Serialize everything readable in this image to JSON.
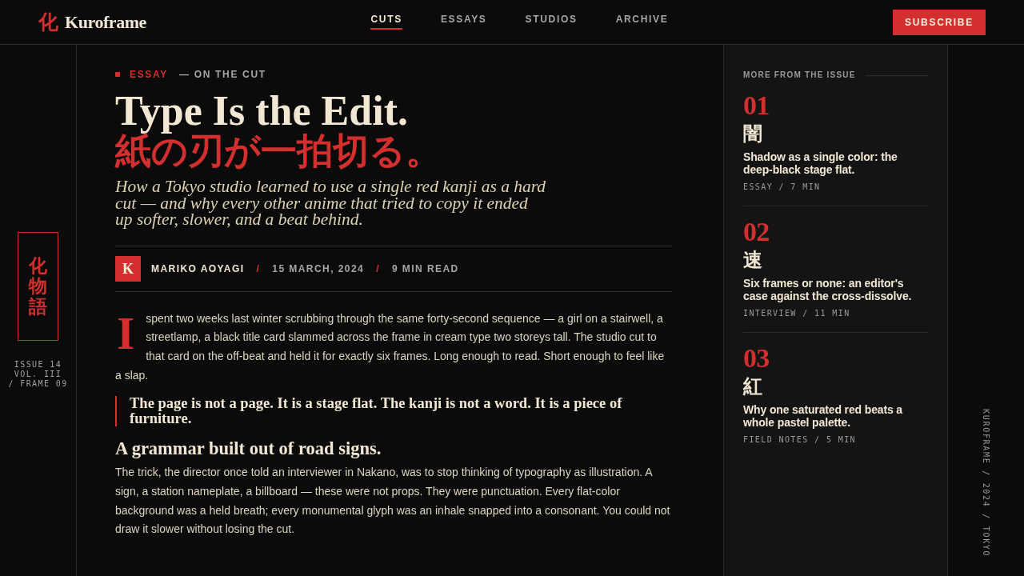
{
  "header": {
    "logo_mark": "化",
    "logo_text": "Kuroframe",
    "nav": [
      {
        "label": "CUTS",
        "selected": true
      },
      {
        "label": "ESSAYS",
        "selected": false
      },
      {
        "label": "STUDIOS",
        "selected": false
      },
      {
        "label": "ARCHIVE",
        "selected": false
      }
    ],
    "subscribe": "SUBSCRIBE"
  },
  "left_rail": {
    "kanji": "化物語",
    "issue_lines": [
      "ISSUE 14",
      "VOL. III",
      "/ FRAME 09"
    ]
  },
  "article": {
    "category": "ESSAY",
    "section": "— ON THE CUT",
    "title": "Type Is the Edit.",
    "title_jp": "紙の刃が一拍切る。",
    "dek": "How a Tokyo studio learned to use a single red kanji as a hard cut — and why every other anime that tried to copy it ended up softer, slower, and a beat behind.",
    "author_initial": "K",
    "byline": [
      {
        "kind": "author",
        "text": "MARIKO AOYAGI"
      },
      {
        "kind": "separator",
        "text": "/"
      },
      {
        "kind": "meta",
        "text": "15 MARCH, 2024"
      },
      {
        "kind": "separator",
        "text": "/"
      },
      {
        "kind": "meta",
        "text": "9 MIN READ"
      }
    ],
    "body": [
      {
        "kind": "paragraph",
        "drop_cap": "I",
        "text": "spent two weeks last winter scrubbing through the same forty-second sequence — a girl on a stairwell, a streetlamp, a black title card slammed across the frame in cream type two storeys tall. The studio cut to that card on the off-beat and held it for exactly six frames. Long enough to read. Short enough to feel like a slap."
      },
      {
        "kind": "pullquote",
        "text": "The page is not a page. It is a stage flat. The kanji is not a word. It is a piece of furniture."
      },
      {
        "kind": "heading",
        "text": "A grammar built out of road signs."
      },
      {
        "kind": "paragraph",
        "text": "The trick, the director once told an interviewer in Nakano, was to stop thinking of typography as illustration. A sign, a station nameplate, a billboard — these were not props. They were punctuation. Every flat-color background was a held breath; every monumental glyph was an inhale snapped into a consonant. You could not draw it slower without losing the cut."
      }
    ]
  },
  "sidebar": {
    "heading": "MORE FROM THE ISSUE",
    "items": [
      {
        "number": "01",
        "kanji": "闇",
        "title": "Shadow as a single color: the deep-black stage flat.",
        "meta": "ESSAY / 7 MIN"
      },
      {
        "number": "02",
        "kanji": "速",
        "title": "Six frames or none: an editor's case against the cross-dissolve.",
        "meta": "INTERVIEW / 11 MIN"
      },
      {
        "number": "03",
        "kanji": "紅",
        "title": "Why one saturated red beats a whole pastel palette.",
        "meta": "FIELD NOTES / 5 MIN"
      }
    ]
  },
  "right_rail": {
    "caption": "KUROFRAME / 2024 / TOKYO"
  }
}
